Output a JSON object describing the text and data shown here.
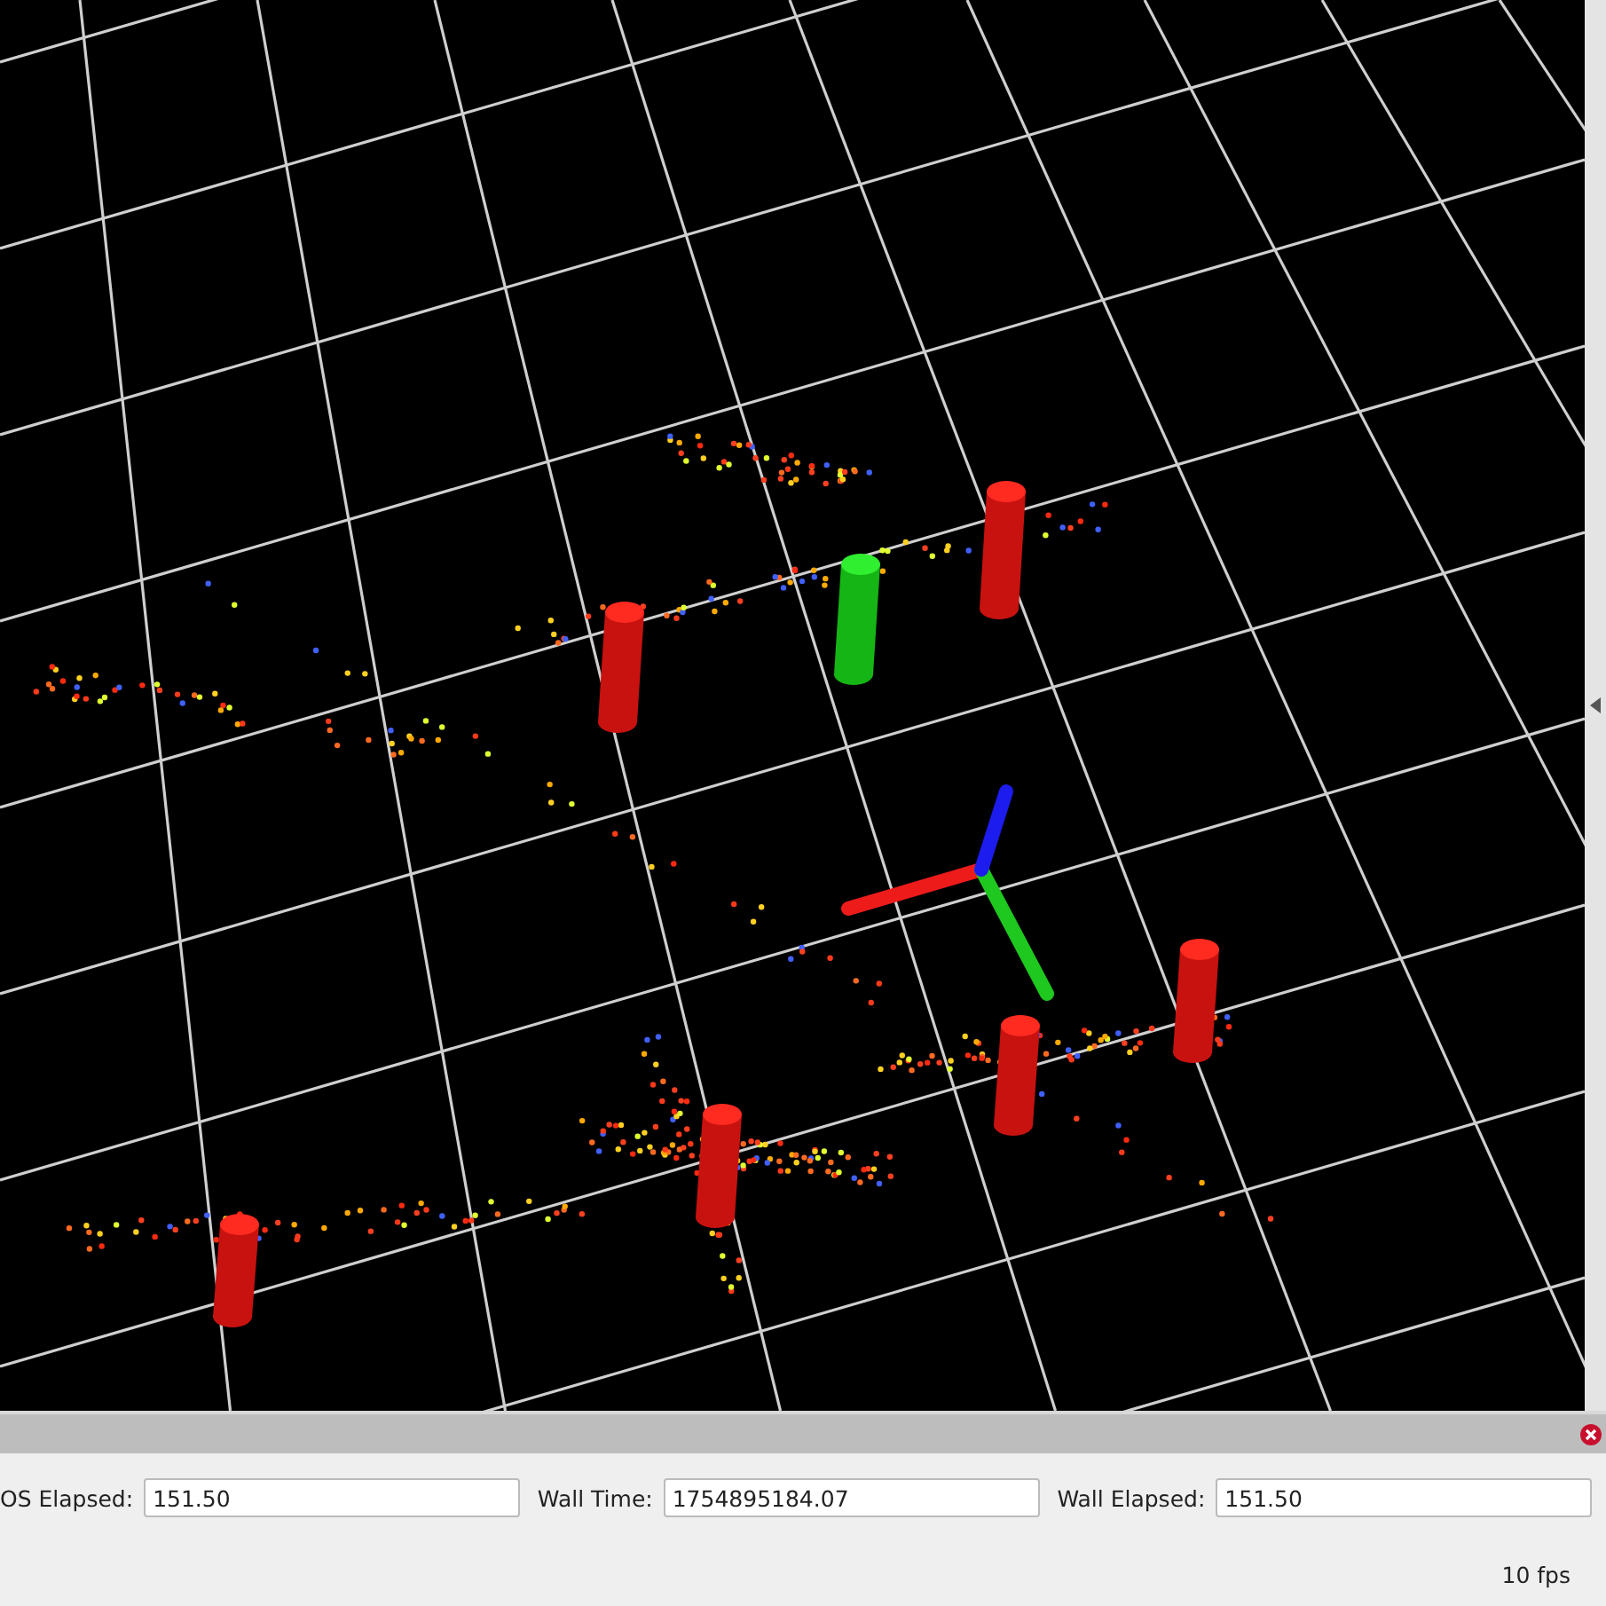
{
  "time_panel": {
    "fields": [
      {
        "label": "OS Elapsed:",
        "value": "151.50"
      },
      {
        "label": "Wall Time:",
        "value": "1754895184.07"
      },
      {
        "label": "Wall Elapsed:",
        "value": "151.50"
      }
    ]
  },
  "status_bar": {
    "fps": "10 fps"
  }
}
